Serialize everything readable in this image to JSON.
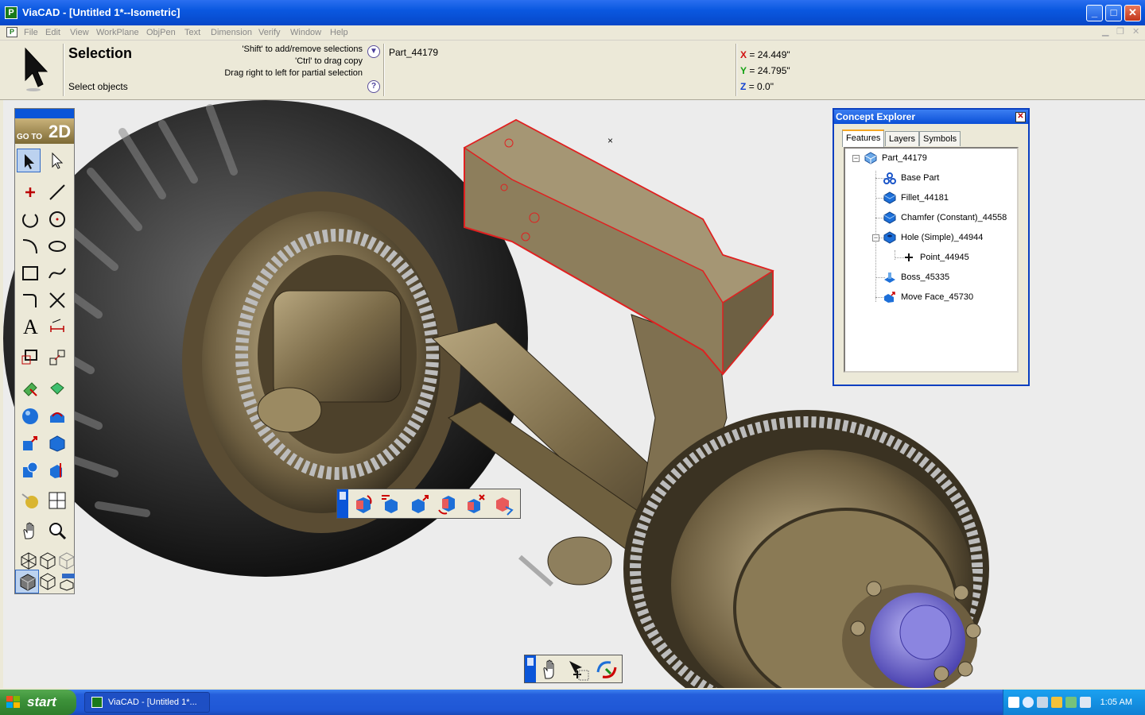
{
  "window": {
    "title": "ViaCAD - [Untitled 1*--Isometric]",
    "app_icon": "P"
  },
  "caption_buttons": [
    "minimize-icon",
    "maximize-icon",
    "close-icon"
  ],
  "menu": [
    "File",
    "Edit",
    "View",
    "WorkPlane",
    "ObjPen",
    "Text",
    "Dimension",
    "Verify",
    "Window",
    "Help"
  ],
  "prompt": {
    "heading": "Selection",
    "sub": "Select objects",
    "hints": [
      "'Shift' to add/remove selections",
      "'Ctrl' to drag copy",
      "Drag right to left for partial selection"
    ],
    "dropdown_icon": "▼",
    "help_icon": "?",
    "part": "Part_44179",
    "coords": {
      "x_label": "X",
      "x": "= 24.449\"",
      "y_label": "Y",
      "y": "= 24.795\"",
      "z_label": "Z",
      "z": "= 0.0\""
    }
  },
  "toolbox": {
    "goto_small": "GO TO",
    "goto_big": "2D",
    "text_tool": "A"
  },
  "explorer": {
    "title": "Concept Explorer",
    "tabs": [
      "Features",
      "Layers",
      "Symbols"
    ],
    "tree": {
      "root": "Part_44179",
      "items": [
        "Base Part",
        "Fillet_44181",
        "Chamfer (Constant)_44558",
        "Hole (Simple)_44944",
        "Point_44945",
        "Boss_45335",
        "Move Face_45730"
      ]
    }
  },
  "colors": {
    "accent": "#0a55d8",
    "selection": "#e02020",
    "coord_x": "#d01010",
    "coord_y": "#10a010",
    "coord_z": "#1040d0"
  },
  "taskbar": {
    "start": "start",
    "task": "ViaCAD - [Untitled 1*...",
    "clock": "1:05 AM"
  }
}
